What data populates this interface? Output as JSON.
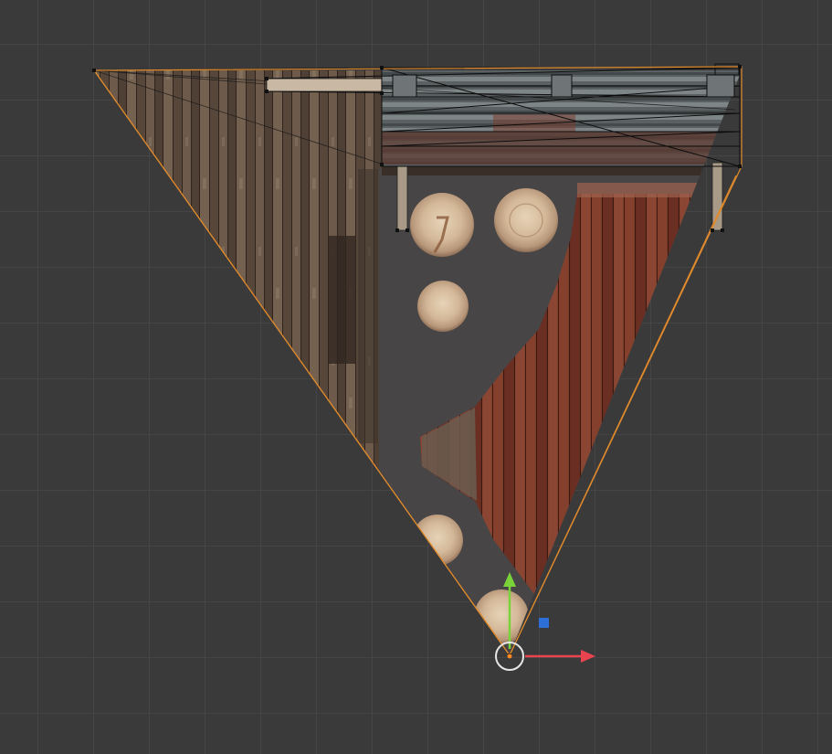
{
  "editor": {
    "type": "UV Editor",
    "background_color": "#3a3a3a",
    "grid_color": "#454545"
  },
  "mesh": {
    "edge_selected_color": "#e08a2c",
    "vertex_color": "#111111"
  },
  "gizmo": {
    "x_axis_color": "#e8434f",
    "y_axis_color": "#7bd33a",
    "plane_handle_color": "#2d6fd6",
    "pivot_color": "#ff8a1e",
    "ring_color": "#e6e6e6"
  },
  "textures": {
    "left_wood_color": "#5e4d40",
    "right_wood_color": "#7a3526",
    "metal_color": "#555a5b",
    "log_end_color": "#d8bfa0"
  }
}
